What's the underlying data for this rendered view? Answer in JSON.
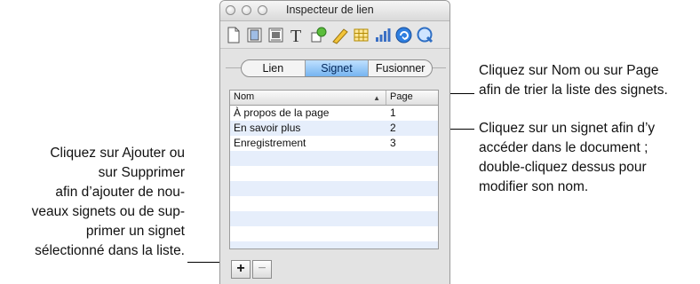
{
  "window": {
    "title": "Inspecteur de lien",
    "toolbar_icons": [
      "document-icon",
      "layout-icon",
      "wrap-icon",
      "text-icon",
      "graphic-icon",
      "metrics-icon",
      "table-icon",
      "chart-icon",
      "link-icon",
      "quicktime-icon"
    ],
    "active_toolbar_icon": "link-icon"
  },
  "tabs": [
    {
      "label": "Lien",
      "active": false
    },
    {
      "label": "Signet",
      "active": true
    },
    {
      "label": "Fusionner",
      "active": false
    }
  ],
  "table": {
    "columns": [
      "Nom",
      "Page"
    ],
    "rows": [
      {
        "name": "À propos de la page",
        "page": "1"
      },
      {
        "name": "En savoir plus",
        "page": "2"
      },
      {
        "name": "Enregistrement",
        "page": "3"
      }
    ]
  },
  "buttons": {
    "add": "+",
    "remove": "−"
  },
  "callouts": {
    "sort": [
      "Cliquez sur Nom ou sur Page",
      "afin de trier la liste des signets."
    ],
    "click": [
      "Cliquez sur un signet afin d’y",
      "accéder dans le document ;",
      "double-cliquez dessus pour",
      "modifier son nom."
    ],
    "add_remove": [
      "Cliquez sur Ajouter ou",
      "sur Supprimer",
      "afin d’ajouter de nou-",
      "veaux signets ou de sup-",
      "primer un signet",
      "sélectionné dans la liste."
    ]
  },
  "colors": {
    "accent": "#2f7fe0",
    "row_stripe": "#e6eefb"
  }
}
